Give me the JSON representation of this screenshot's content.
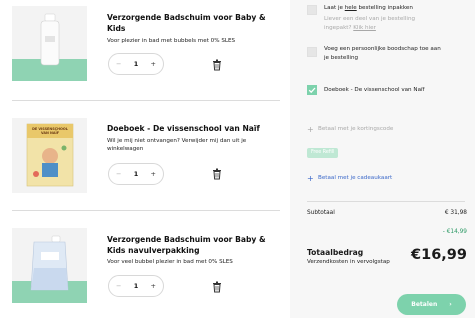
{
  "cart": {
    "items": [
      {
        "title": "Verzorgende Badschuim voor Baby & Kids",
        "description": "Voor plezier in bad met bubbels met 0% SLES",
        "quantity": "1"
      },
      {
        "title": "Doeboek - De vissenschool van Naïf",
        "description": "Wil je mij niet ontvangen? Verwijder mij dan uit je winkelwagen",
        "quantity": "1"
      },
      {
        "title": "Verzorgende Badschuim voor Baby & Kids navulverpakking",
        "description": "Voor veel bubbel plezier in bad met 0% SLES",
        "quantity": "1"
      }
    ],
    "minus_symbol": "−",
    "plus_symbol": "+",
    "book_cover_text": "DE VISSENSCHOOL VAN NAÏF"
  },
  "summary": {
    "options": {
      "gift_wrap_prefix": "Laat je ",
      "gift_wrap_emph": "hele",
      "gift_wrap_suffix": " bestelling inpakken",
      "gift_wrap_note": "Liever een deel van je bestelling ingepakt? ",
      "gift_wrap_link": "Klik hier",
      "personal_message": "Voeg een persoonlijke boodschap toe aan je bestelling",
      "free_item": "Doeboek - De vissenschool van Naïf"
    },
    "discount_code": "Betaal met je kortingscode",
    "free_badge": "Free Refill",
    "gift_card": "Betaal met je cadeaukaart",
    "subtotal_label": "Subtotaal",
    "subtotal_value": "€ 31,98",
    "discount_value": "- €14,99",
    "total_label": "Totaalbedrag",
    "shipping_note": "Verzendkosten in vervolgstap",
    "total_value": "€16,99",
    "pay_label": "Betalen",
    "pay_arrow": "›"
  },
  "colors": {
    "accent_green": "#7dd2ac",
    "link_blue": "#3b68c9",
    "discount_green": "#2e9a66"
  }
}
